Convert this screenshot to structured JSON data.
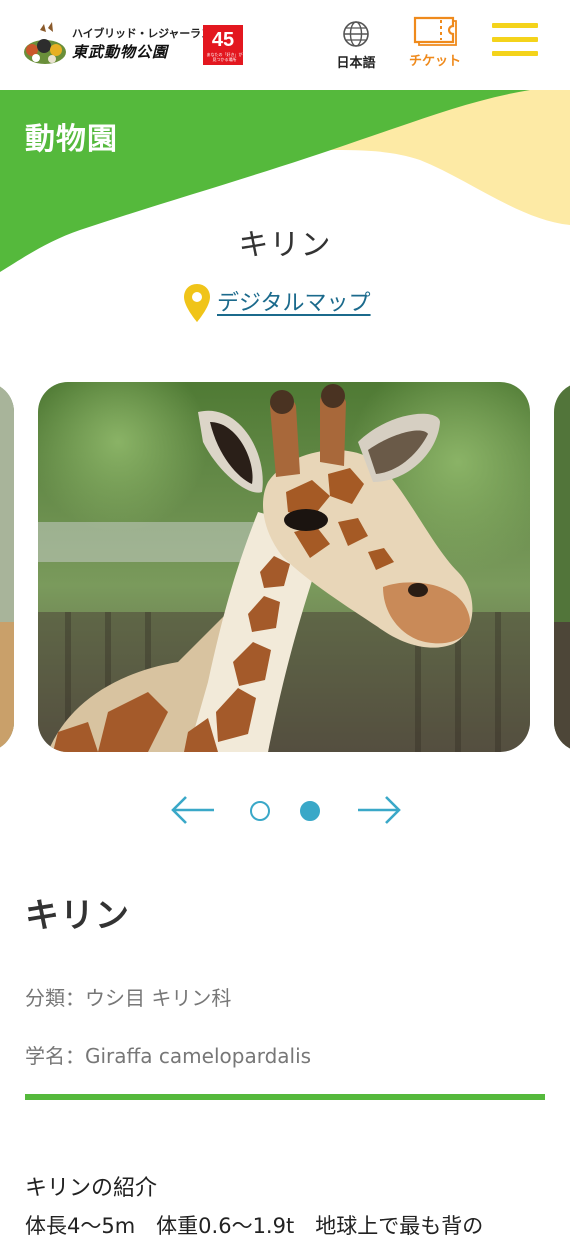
{
  "header": {
    "logo_tagline": "ハイブリッド・レジャーランド",
    "logo_name": "東武動物公園",
    "logo_badge": "45",
    "logo_badge_small": "あなたの「好き」が見つかる場所",
    "language_label": "日本語",
    "ticket_label": "チケット",
    "colors": {
      "ticket": "#ef8a1c",
      "menu": "#f4d31b"
    }
  },
  "hero": {
    "title": "動物園",
    "colors": {
      "green": "#55b93c",
      "cream": "#fdeaa5"
    }
  },
  "animal": {
    "heading": "キリン",
    "map_link_label": "デジタルマップ"
  },
  "carousel": {
    "slide_count": 2,
    "active_slide": 2,
    "main_image_alt": "reticulated giraffe head and neck"
  },
  "info": {
    "name": "キリン",
    "classification": "分類：ウシ目 キリン科",
    "scientific_name": "学名：Giraffa camelopardalis",
    "intro_heading": "キリンの紹介",
    "intro_text": "体長4〜5m　体重0.6〜1.9t　地球上で最も背の"
  },
  "colors": {
    "accent_blue": "#3aa8c8",
    "link_blue": "#1b6a8c",
    "pin_yellow": "#f0c419",
    "divider_green": "#55b93c"
  }
}
